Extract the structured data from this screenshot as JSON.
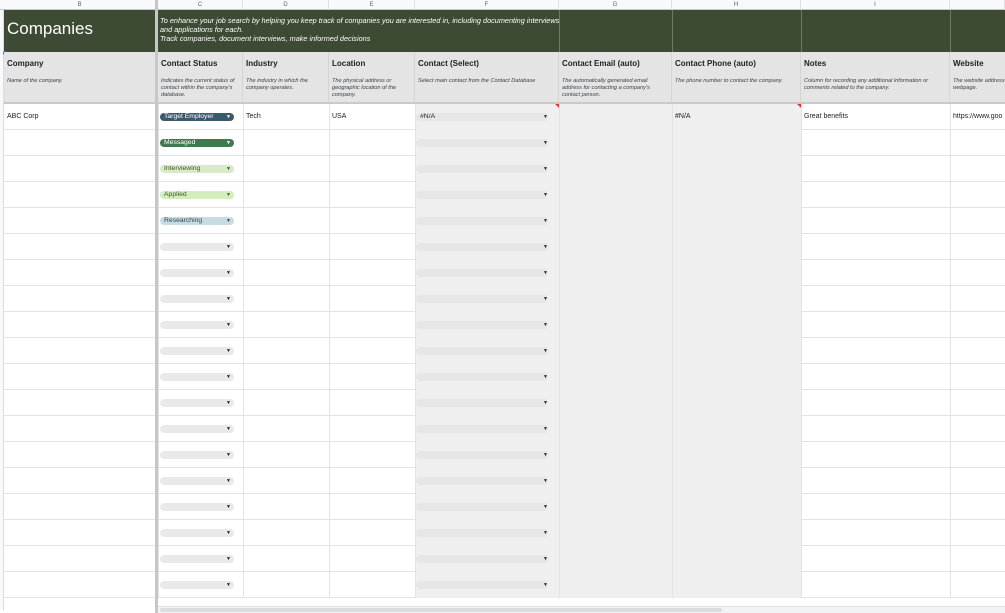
{
  "column_letters": [
    "B",
    "C",
    "D",
    "E",
    "F",
    "G",
    "H",
    "I"
  ],
  "banner": {
    "title": "Companies",
    "description_line1": "To enhance your job search by helping you keep track of companies you are interested in, including documenting interviews and applications for each.",
    "description_line2": "Track companies, document interviews, make informed decisions"
  },
  "headers": [
    {
      "title": "Company",
      "desc": "Name of the company."
    },
    {
      "title": "Contact Status",
      "desc": "Indicates the current status of contact within the company's database."
    },
    {
      "title": "Industry",
      "desc": "The industry in which the company operates."
    },
    {
      "title": "Location",
      "desc": "The physical address or geographic location of the company."
    },
    {
      "title": "Contact (Select)",
      "desc": "Select main contact from the Contact Database"
    },
    {
      "title": "Contact Email (auto)",
      "desc": "The automatically generated email address for contacting a company's contact person."
    },
    {
      "title": "Contact Phone (auto)",
      "desc": "The phone number to contact the company."
    },
    {
      "title": "Notes",
      "desc": "Column for recording any additional information or comments related to the company."
    },
    {
      "title": "Website",
      "desc": "The website address webpage."
    }
  ],
  "first_row": {
    "company": "ABC Corp",
    "industry": "Tech",
    "location": "USA",
    "contact": "#N/A",
    "phone": "#N/A",
    "notes": "Great benefits",
    "website": "https://www.goo"
  },
  "status_chips": [
    {
      "label": "Target Employer",
      "bg": "#3d5a6c",
      "fg": "#ffffff"
    },
    {
      "label": "Messaged",
      "bg": "#3f7a4f",
      "fg": "#ffffff"
    },
    {
      "label": "Interviewing",
      "bg": "#d9eac8",
      "fg": "#3c5a2a"
    },
    {
      "label": "Applied",
      "bg": "#d4edbc",
      "fg": "#3c5a2a"
    },
    {
      "label": "Researching",
      "bg": "#c9dbe1",
      "fg": "#2d4752"
    }
  ],
  "empty_row_count": 14,
  "icons": {
    "dropdown": "caret-down-icon"
  },
  "colors": {
    "banner": "#3e4b34",
    "header_bg": "#e4e4e4",
    "auto_column_shade": "#efefef"
  }
}
